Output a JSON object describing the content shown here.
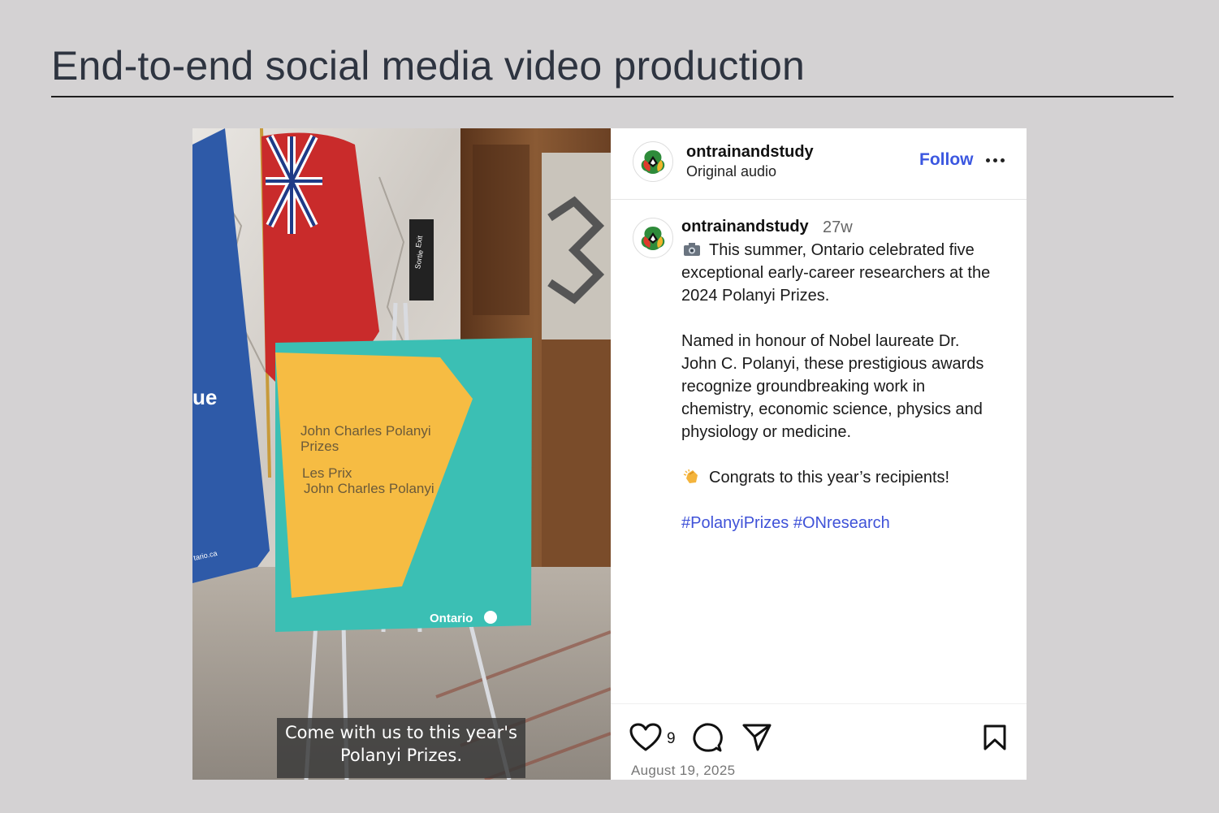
{
  "slide": {
    "title": "End-to-end social media video production"
  },
  "video": {
    "subtitle_line1": "Come with us to this year's",
    "subtitle_line2": "Polanyi Prizes.",
    "sign_line1": "John Charles Polanyi",
    "sign_line2": "Prizes",
    "sign_line3": "Les Prix",
    "sign_line4": "John Charles Polanyi",
    "sign_brand": "Ontario",
    "banner_text": "ue",
    "banner_url": "tario.ca",
    "exit_sign_1": "Exit",
    "exit_sign_2": "Sortie"
  },
  "post": {
    "header": {
      "username": "ontrainandstudy",
      "audio": "Original audio",
      "follow_label": "Follow",
      "more_icon": "ellipsis-icon"
    },
    "caption": {
      "username": "ontrainandstudy",
      "age": "27w",
      "line1": "This summer, Ontario celebrated five",
      "line2": "exceptional early-career researchers at the",
      "line3": "2024 Polanyi Prizes.",
      "line4": "Named in honour of Nobel laureate Dr.",
      "line5": "John C. Polanyi, these prestigious awards",
      "line6": "recognize groundbreaking work in",
      "line7": "chemistry, economic science, physics and",
      "line8": "physiology or medicine.",
      "line9": "Congrats to this year’s recipients!",
      "hashtags": "#PolanyiPrizes #ONresearch"
    },
    "actions": {
      "like_count": "9",
      "date": "August 19, 2025"
    },
    "colors": {
      "link_blue": "#3b57e0",
      "teal": "#3bbfb4",
      "sign_yellow": "#f6bc43"
    }
  }
}
